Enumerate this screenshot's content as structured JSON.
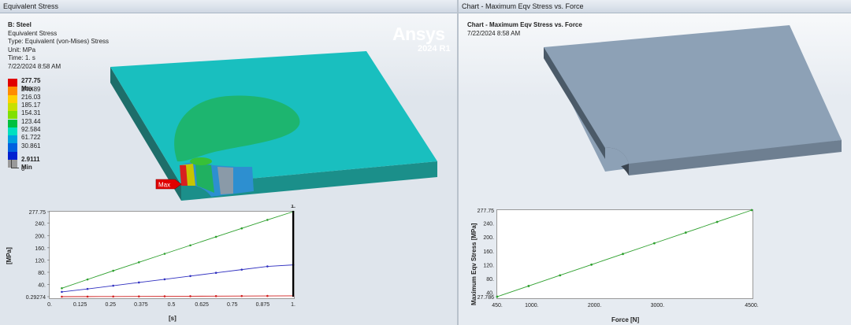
{
  "left_pane": {
    "title": "Equivalent Stress",
    "info": {
      "name": "B: Steel",
      "line2": "Equivalent Stress",
      "type": "Type: Equivalent (von-Mises) Stress",
      "unit": "Unit: MPa",
      "time": "Time: 1. s",
      "date": "7/22/2024 8:58 AM"
    },
    "legend": {
      "max_label": "277.75 Max",
      "labels": [
        "246.89",
        "216.03",
        "185.17",
        "154.31",
        "123.44",
        "92.584",
        "61.722",
        "30.861"
      ],
      "min_label": "2.9111 Min",
      "zero": "0",
      "colors": [
        "#e00000",
        "#ff8c00",
        "#ffd000",
        "#c8e000",
        "#80e000",
        "#00c040",
        "#00e0c0",
        "#00a0e0",
        "#0060e0",
        "#0020d0"
      ]
    },
    "logo": {
      "name": "Ansys",
      "version": "2024 R1"
    },
    "probe_label": "Max",
    "chart_data": {
      "type": "line",
      "x": [
        0.05,
        0.125,
        0.25,
        0.375,
        0.5,
        0.625,
        0.75,
        0.875,
        1.0
      ],
      "series": [
        {
          "color": "#2ea02e",
          "values": [
            27.786,
            56.5,
            84.9,
            112.6,
            140.3,
            167.9,
            195.6,
            223.3,
            251.0,
            277.75
          ]
        },
        {
          "color": "#3030c0",
          "values": [
            16,
            25.6,
            36.1,
            46.6,
            57.1,
            67.6,
            78.1,
            88.6,
            99.1,
            104
          ]
        },
        {
          "color": "#d02020",
          "values": [
            0.29274,
            0.6,
            0.9,
            1.2,
            1.5,
            1.8,
            2.1,
            2.4,
            2.7,
            2.9111
          ]
        }
      ],
      "ylabel": "[MPa]",
      "xlabel": "[s]",
      "yticks": [
        "277.75",
        "240.",
        "200.",
        "160.",
        "120.",
        "80.",
        "40.",
        "0.29274"
      ],
      "xticks": [
        "0.",
        "0.125",
        "0.25",
        "0.375",
        "0.5",
        "0.625",
        "0.75",
        "0.875",
        "1."
      ],
      "marker_label": "1.",
      "ylim": [
        0.29274,
        277.75
      ],
      "xlim": [
        0,
        1
      ]
    }
  },
  "right_pane": {
    "title": "Chart - Maximum Eqv Stress vs. Force",
    "header": "Chart - Maximum Eqv Stress vs. Force",
    "date": "7/22/2024 8:58 AM",
    "chart_data": {
      "type": "line",
      "x": [
        450,
        950,
        1450,
        1950,
        2450,
        2950,
        3450,
        3950,
        4500
      ],
      "values": [
        27.786,
        58.6,
        89.5,
        120.3,
        151.2,
        182.0,
        212.8,
        243.7,
        277.75
      ],
      "series_color": "#2ea02e",
      "xlabel": "Force [N]",
      "ylabel": "Maximum Eqv Stress [MPa]",
      "yticks": [
        "277.75",
        "240.",
        "200.",
        "160.",
        "120.",
        "80.",
        "40.",
        "27.786"
      ],
      "xticks": [
        "450.",
        "1000.",
        "2000.",
        "3000.",
        "4500."
      ],
      "xlim": [
        450,
        4500
      ],
      "ylim": [
        27.786,
        277.75
      ]
    }
  }
}
